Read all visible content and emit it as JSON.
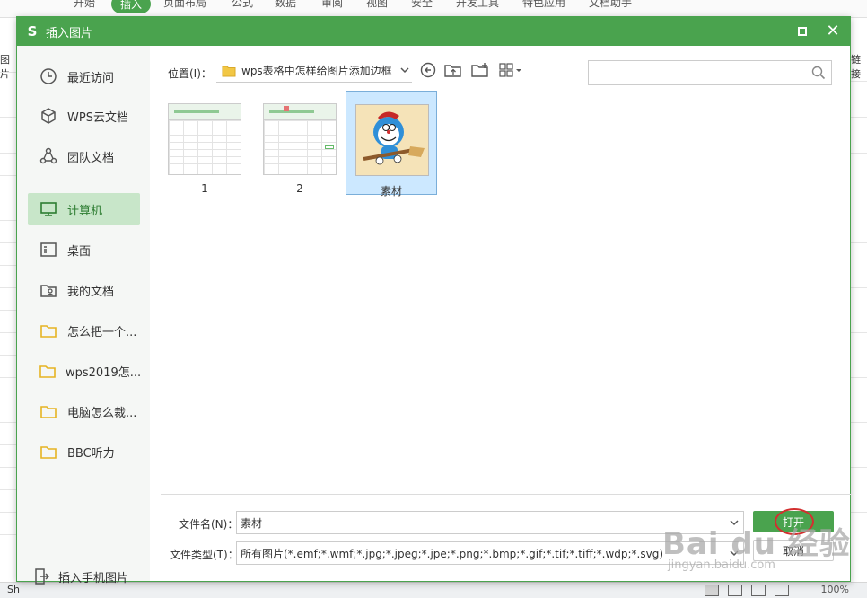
{
  "background": {
    "ribbon_tabs": [
      "开始",
      "插入",
      "页面布局",
      "公式",
      "数据",
      "审阅",
      "视图",
      "安全",
      "开发工具",
      "特色应用",
      "文档助手"
    ],
    "active_tab": "插入",
    "left_labels": [
      "图片"
    ],
    "right_labels": [
      "链接"
    ],
    "status": {
      "sheet_label": "Sh",
      "zoom": "100%"
    }
  },
  "dialog": {
    "title": "插入图片",
    "logo": "S",
    "accent": "#4aa34e"
  },
  "sidebar": {
    "items": [
      {
        "label": "最近访问",
        "icon": "clock-icon"
      },
      {
        "label": "WPS云文档",
        "icon": "cube-icon"
      },
      {
        "label": "团队文档",
        "icon": "team-icon"
      },
      {
        "label": "计算机",
        "icon": "monitor-icon",
        "active": true
      },
      {
        "label": "桌面",
        "icon": "desktop-icon"
      },
      {
        "label": "我的文档",
        "icon": "user-folder-icon"
      },
      {
        "label": "怎么把一个...",
        "icon": "folder-icon"
      },
      {
        "label": "wps2019怎...",
        "icon": "folder-icon"
      },
      {
        "label": "电脑怎么裁...",
        "icon": "folder-icon"
      },
      {
        "label": "BBC听力",
        "icon": "folder-icon"
      }
    ],
    "bottom_label": "插入手机图片"
  },
  "toolbar": {
    "location_label": "位置(I)：",
    "path": "wps表格中怎样给图片添加边框",
    "search_placeholder": ""
  },
  "files": [
    {
      "name": "1",
      "kind": "spreadsheet-screenshot",
      "selected": false
    },
    {
      "name": "2",
      "kind": "spreadsheet-screenshot",
      "selected": false
    },
    {
      "name": "素材",
      "kind": "cartoon-image",
      "selected": true
    }
  ],
  "form": {
    "filename_label": "文件名(N)：",
    "filename_value": "素材",
    "filetype_label": "文件类型(T)：",
    "filetype_value": "所有图片(*.emf;*.wmf;*.jpg;*.jpeg;*.jpe;*.png;*.bmp;*.gif;*.tif;*.tiff;*.wdp;*.svg)",
    "open_label": "打开",
    "cancel_label": "取消"
  },
  "watermark": {
    "main": "Bai du 经验",
    "sub": "jingyan.baidu.com"
  }
}
